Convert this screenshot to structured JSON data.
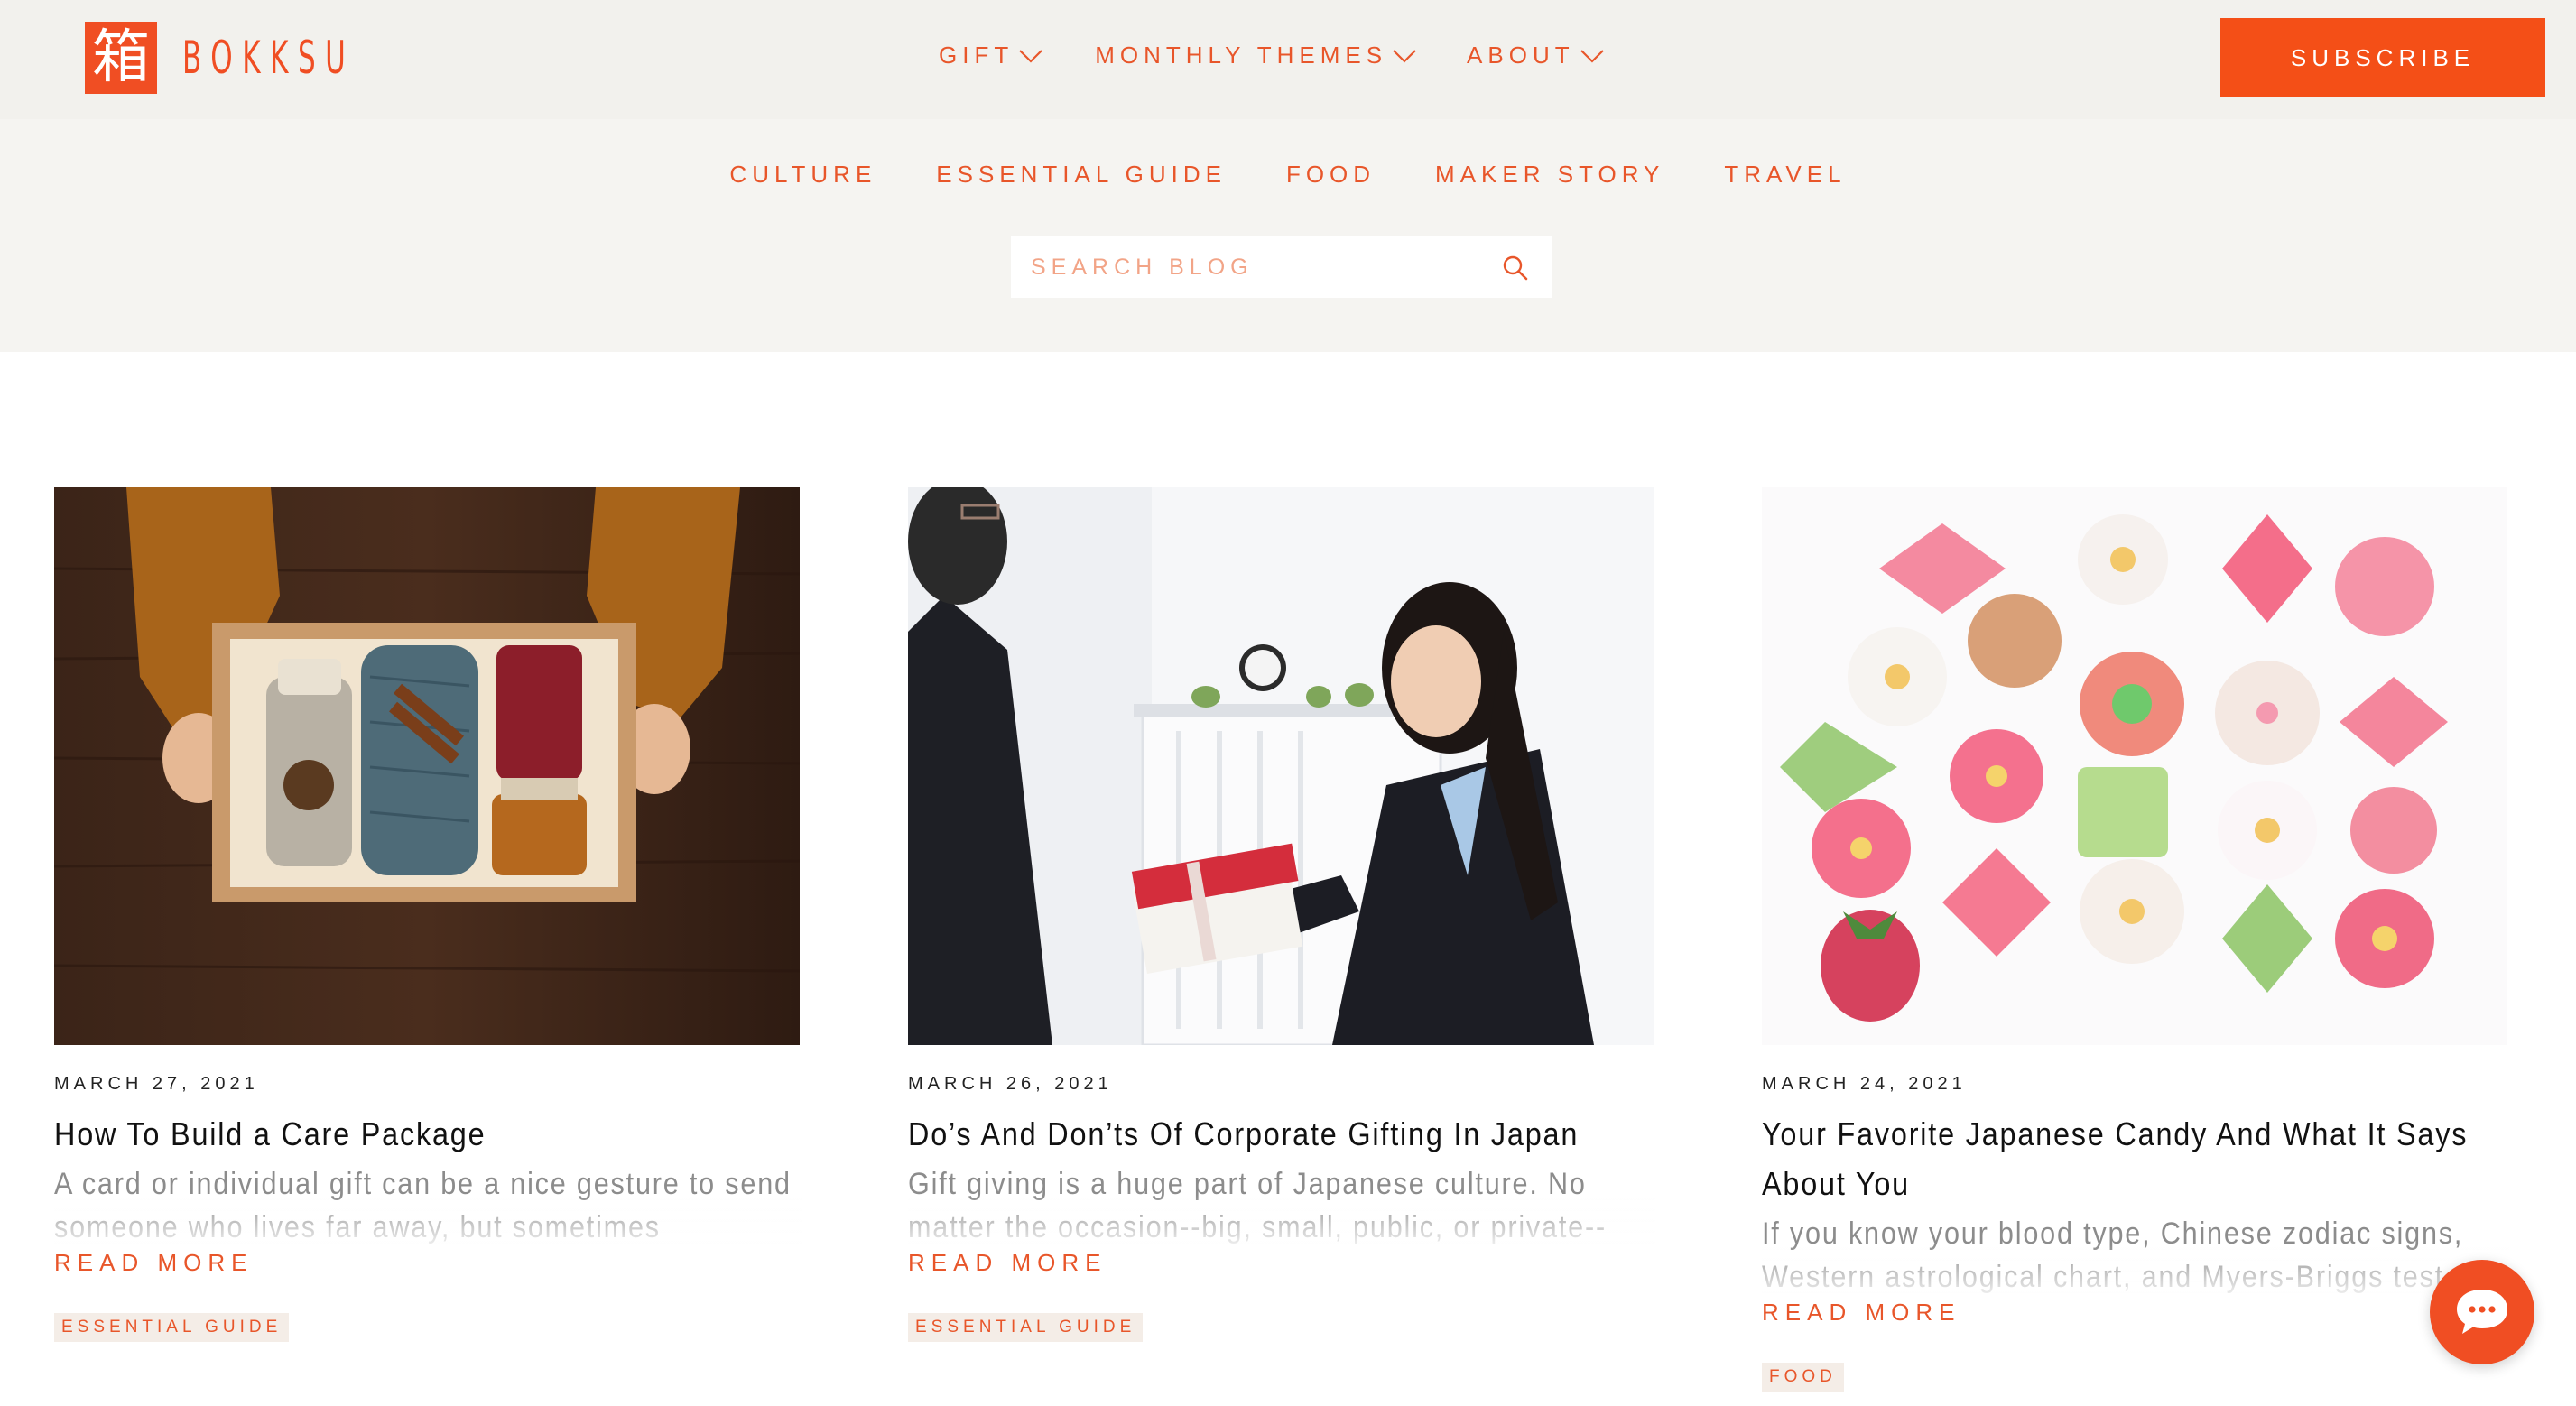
{
  "brand": {
    "mark": "箱",
    "wordmark": "BOKKSU",
    "accent_color": "#f04e23"
  },
  "header": {
    "nav": [
      {
        "label": "GIFT",
        "icon": "chevron-down-icon"
      },
      {
        "label": "MONTHLY THEMES",
        "icon": "chevron-down-icon"
      },
      {
        "label": "ABOUT",
        "icon": "chevron-down-icon"
      }
    ],
    "subscribe_label": "SUBSCRIBE"
  },
  "blog": {
    "categories": [
      "CULTURE",
      "ESSENTIAL GUIDE",
      "FOOD",
      "MAKER STORY",
      "TRAVEL"
    ],
    "search": {
      "placeholder": "SEARCH BLOG",
      "value": "",
      "icon": "search-icon"
    }
  },
  "posts": [
    {
      "date": "MARCH 27, 2021",
      "title": "How To Build a Care Package",
      "excerpt": "A card or individual gift can be a nice gesture to send someone who lives far away, but sometimes",
      "read_more": "READ MORE",
      "tag": "ESSENTIAL GUIDE"
    },
    {
      "date": "MARCH 26, 2021",
      "title": "Do’s And Don’ts Of Corporate Gifting In Japan",
      "excerpt": "Gift giving is a huge part of Japanese culture. No matter the occasion--big, small, public, or private--",
      "read_more": "READ MORE",
      "tag": "ESSENTIAL GUIDE"
    },
    {
      "date": "MARCH 24, 2021",
      "title": "Your Favorite Japanese Candy And What It Says About You",
      "excerpt": "If you know your blood type, Chinese zodiac signs, Western astrological chart, and Myers-Briggs test",
      "read_more": "READ MORE",
      "tag": "FOOD"
    }
  ],
  "chat": {
    "icon": "chat-bubble-icon"
  }
}
